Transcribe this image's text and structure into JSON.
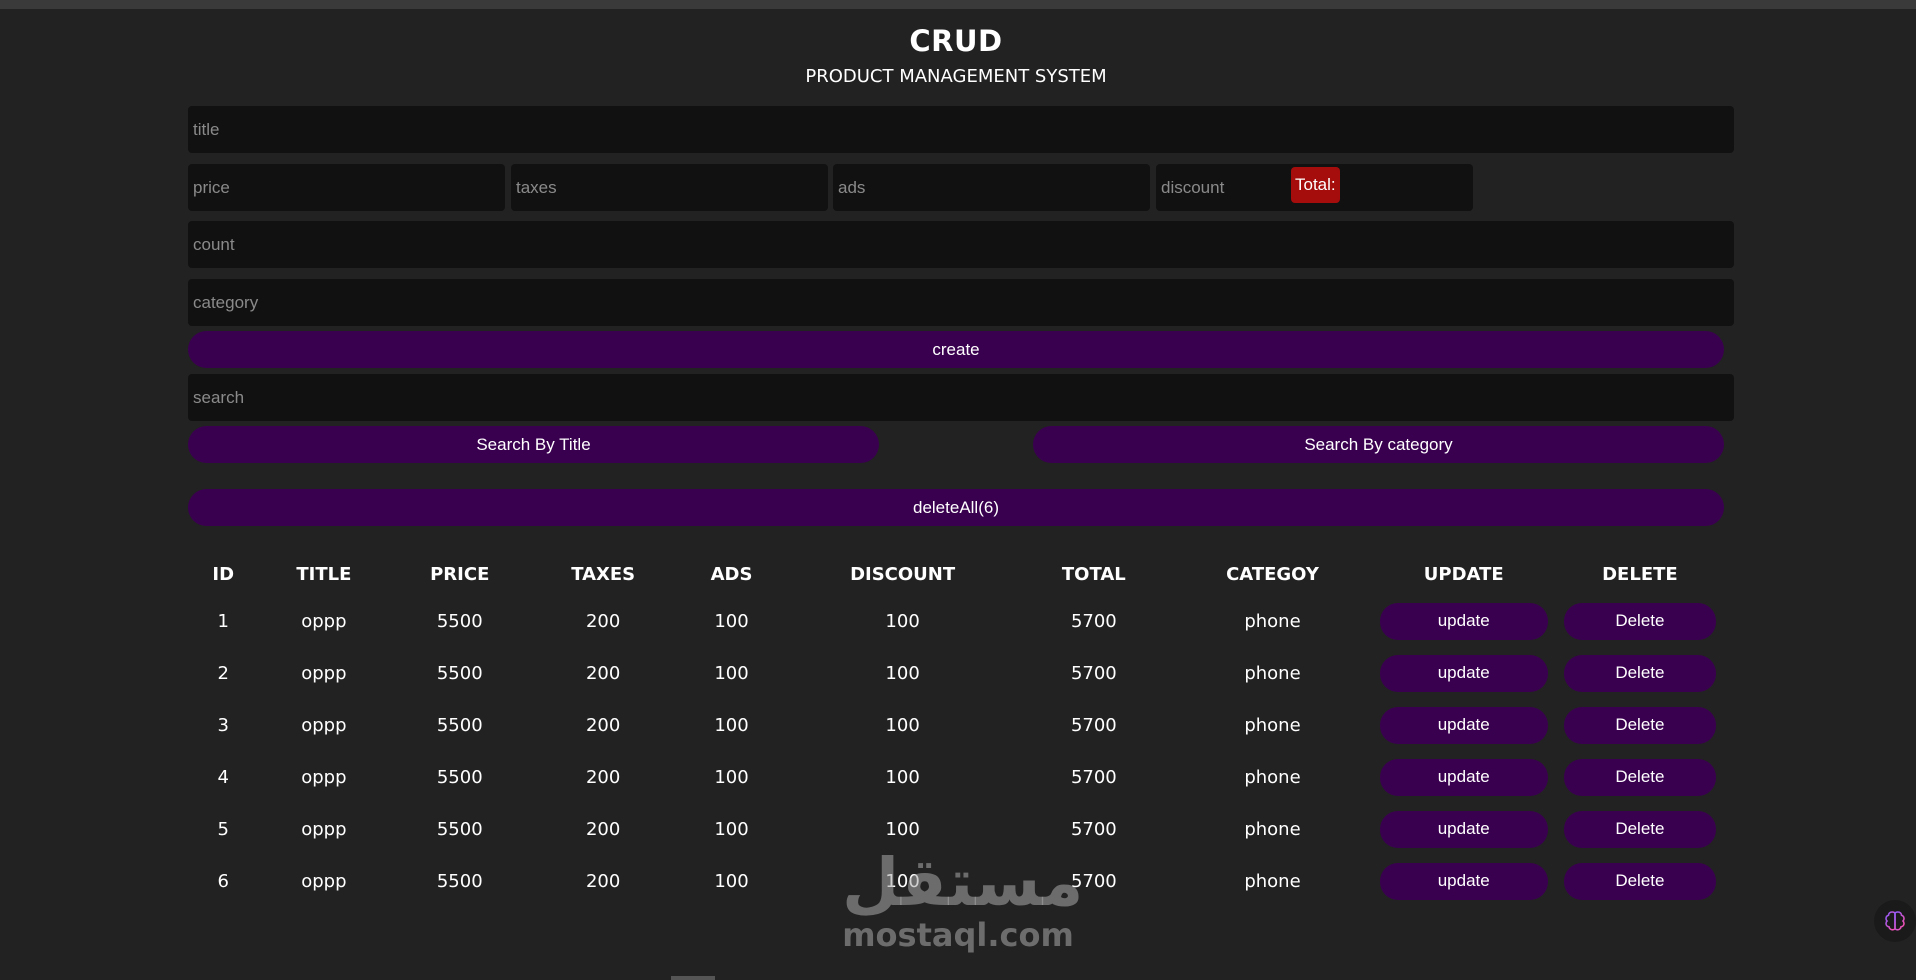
{
  "header": {
    "title": "CRUD",
    "subtitle": "PRODUCT MANAGEMENT SYSTEM"
  },
  "form": {
    "title_placeholder": "title",
    "price_placeholder": "price",
    "taxes_placeholder": "taxes",
    "ads_placeholder": "ads",
    "discount_placeholder": "discount",
    "total_label": "Total:",
    "count_placeholder": "count",
    "category_placeholder": "category",
    "create_label": "create"
  },
  "search": {
    "placeholder": "search",
    "by_title_label": "Search By Title",
    "by_category_label": "Search By category",
    "delete_all_label": "deleteAll(6)"
  },
  "table": {
    "headers": [
      "ID",
      "TITLE",
      "PRICE",
      "TAXES",
      "ADS",
      "DISCOUNT",
      "TOTAL",
      "CATEGOY",
      "UPDATE",
      "DELETE"
    ],
    "rows": [
      {
        "id": "1",
        "title": "oppp",
        "price": "5500",
        "taxes": "200",
        "ads": "100",
        "discount": "100",
        "total": "5700",
        "category": "phone",
        "update": "update",
        "delete": "Delete"
      },
      {
        "id": "2",
        "title": "oppp",
        "price": "5500",
        "taxes": "200",
        "ads": "100",
        "discount": "100",
        "total": "5700",
        "category": "phone",
        "update": "update",
        "delete": "Delete"
      },
      {
        "id": "3",
        "title": "oppp",
        "price": "5500",
        "taxes": "200",
        "ads": "100",
        "discount": "100",
        "total": "5700",
        "category": "phone",
        "update": "update",
        "delete": "Delete"
      },
      {
        "id": "4",
        "title": "oppp",
        "price": "5500",
        "taxes": "200",
        "ads": "100",
        "discount": "100",
        "total": "5700",
        "category": "phone",
        "update": "update",
        "delete": "Delete"
      },
      {
        "id": "5",
        "title": "oppp",
        "price": "5500",
        "taxes": "200",
        "ads": "100",
        "discount": "100",
        "total": "5700",
        "category": "phone",
        "update": "update",
        "delete": "Delete"
      },
      {
        "id": "6",
        "title": "oppp",
        "price": "5500",
        "taxes": "200",
        "ads": "100",
        "discount": "100",
        "total": "5700",
        "category": "phone",
        "update": "update",
        "delete": "Delete"
      }
    ]
  },
  "watermark": {
    "arabic": "مستقل",
    "latin": "mostaql.com"
  },
  "icons": {
    "corner": "brain-icon"
  },
  "colors": {
    "background": "#222222",
    "input_bg": "#111111",
    "button_bg": "#3a0050",
    "total_bg": "#a50d0d"
  }
}
